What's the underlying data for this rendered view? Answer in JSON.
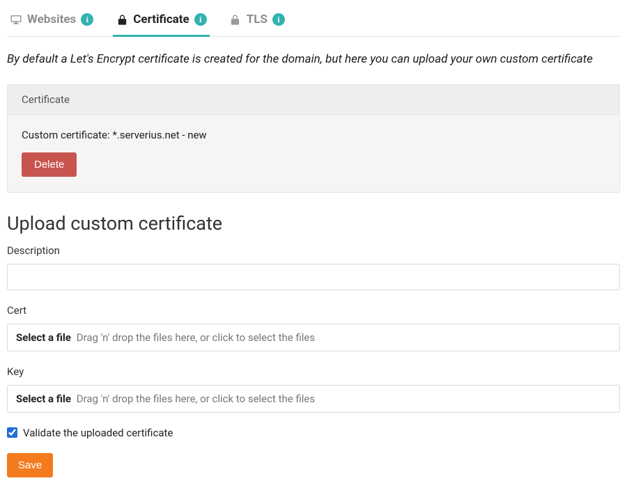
{
  "tabs": {
    "websites": {
      "label": "Websites"
    },
    "certificate": {
      "label": "Certificate"
    },
    "tls": {
      "label": "TLS"
    }
  },
  "intro": "By default a Let's Encrypt certificate is created for the domain, but here you can upload your own custom certificate",
  "panel": {
    "title": "Certificate",
    "body_text": "Custom certificate: *.serverius.net - new",
    "delete_label": "Delete"
  },
  "upload": {
    "heading": "Upload custom certificate",
    "description_label": "Description",
    "description_value": "",
    "cert_label": "Cert",
    "key_label": "Key",
    "file_select_label": "Select a file",
    "file_drop_hint": "Drag 'n' drop the files here, or click to select the files",
    "validate_label": "Validate the uploaded certificate",
    "validate_checked": true,
    "save_label": "Save"
  },
  "info_badge_glyph": "i"
}
